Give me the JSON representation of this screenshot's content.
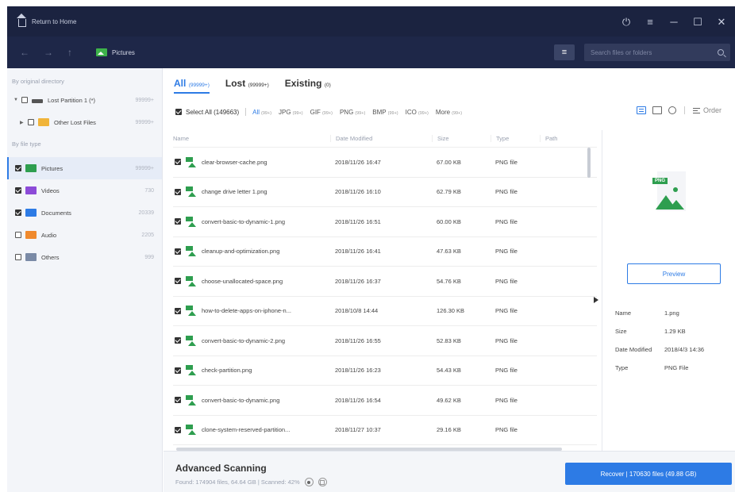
{
  "titlebar": {
    "home_label": "Return to Home",
    "controls": [
      "⏻",
      "≡",
      "─",
      "☐",
      "✕"
    ]
  },
  "navbar": {
    "back": "←",
    "forward": "→",
    "up": "↑",
    "crumb": "Pictures",
    "menu": "≡",
    "search_placeholder": "Search files or folders"
  },
  "sidebar": {
    "group_original": "By original directory",
    "group_type": "By file type",
    "tree": [
      {
        "label": "Lost Partition 1 (*)",
        "count": "99999+"
      },
      {
        "label": "Other Lost Files",
        "count": "99999+"
      }
    ],
    "types": [
      {
        "label": "Pictures",
        "count": "99999+",
        "checked": true
      },
      {
        "label": "Videos",
        "count": "730",
        "checked": true
      },
      {
        "label": "Documents",
        "count": "20339",
        "checked": true
      },
      {
        "label": "Audio",
        "count": "2205",
        "checked": false
      },
      {
        "label": "Others",
        "count": "999",
        "checked": false
      }
    ]
  },
  "tabs": [
    {
      "label": "All",
      "count": "(99999+)"
    },
    {
      "label": "Lost",
      "count": "(99999+)"
    },
    {
      "label": "Existing",
      "count": "(0)"
    }
  ],
  "filters": {
    "select_all": "Select All (149663)",
    "types": [
      {
        "label": "All",
        "count": "(99+)"
      },
      {
        "label": "JPG",
        "count": "(99+)"
      },
      {
        "label": "GIF",
        "count": "(99+)"
      },
      {
        "label": "PNG",
        "count": "(99+)"
      },
      {
        "label": "BMP",
        "count": "(99+)"
      },
      {
        "label": "ICO",
        "count": "(99+)"
      },
      {
        "label": "More",
        "count": "(99+)"
      }
    ],
    "order": "Order"
  },
  "table": {
    "headers": {
      "name": "Name",
      "date": "Date Modified",
      "size": "Size",
      "type": "Type",
      "path": "Path"
    },
    "rows": [
      {
        "name": "clear-browser-cache.png",
        "date": "2018/11/26 16:47",
        "size": "67.00 KB",
        "type": "PNG file"
      },
      {
        "name": "change drive letter 1.png",
        "date": "2018/11/26 16:10",
        "size": "62.79 KB",
        "type": "PNG file"
      },
      {
        "name": "convert-basic-to-dynamic-1.png",
        "date": "2018/11/26 16:51",
        "size": "60.00 KB",
        "type": "PNG file"
      },
      {
        "name": "cleanup-and-optimization.png",
        "date": "2018/11/26 16:41",
        "size": "47.63 KB",
        "type": "PNG file"
      },
      {
        "name": "choose-unallocated-space.png",
        "date": "2018/11/26 16:37",
        "size": "54.76 KB",
        "type": "PNG file"
      },
      {
        "name": "how-to-delete-apps-on-iphone-n...",
        "date": "2018/10/8 14:44",
        "size": "126.30 KB",
        "type": "PNG file"
      },
      {
        "name": "convert-basic-to-dynamic-2.png",
        "date": "2018/11/26 16:55",
        "size": "52.83 KB",
        "type": "PNG file"
      },
      {
        "name": "check-partition.png",
        "date": "2018/11/26 16:23",
        "size": "54.43 KB",
        "type": "PNG file"
      },
      {
        "name": "convert-basic-to-dynamic.png",
        "date": "2018/11/26 16:54",
        "size": "49.62 KB",
        "type": "PNG file"
      },
      {
        "name": "clone-system-reserved-partition...",
        "date": "2018/11/27 10:37",
        "size": "29.16 KB",
        "type": "PNG file"
      }
    ]
  },
  "detail": {
    "badge": "PNG",
    "preview_label": "Preview",
    "props": [
      {
        "k": "Name",
        "v": "1.png"
      },
      {
        "k": "Size",
        "v": "1.29 KB"
      },
      {
        "k": "Date Modified",
        "v": "2018/4/3 14:36"
      },
      {
        "k": "Type",
        "v": "PNG File"
      }
    ]
  },
  "footer": {
    "title": "Advanced Scanning",
    "stats": "Found: 174904 files, 64.64 GB  |  Scanned: 42%",
    "recover_label": "Recover  |  170630 files (49.88 GB)"
  },
  "colors": {
    "titlebar": "#1b2340",
    "accent": "#2d7be5",
    "png_green": "#2e9e4f"
  }
}
